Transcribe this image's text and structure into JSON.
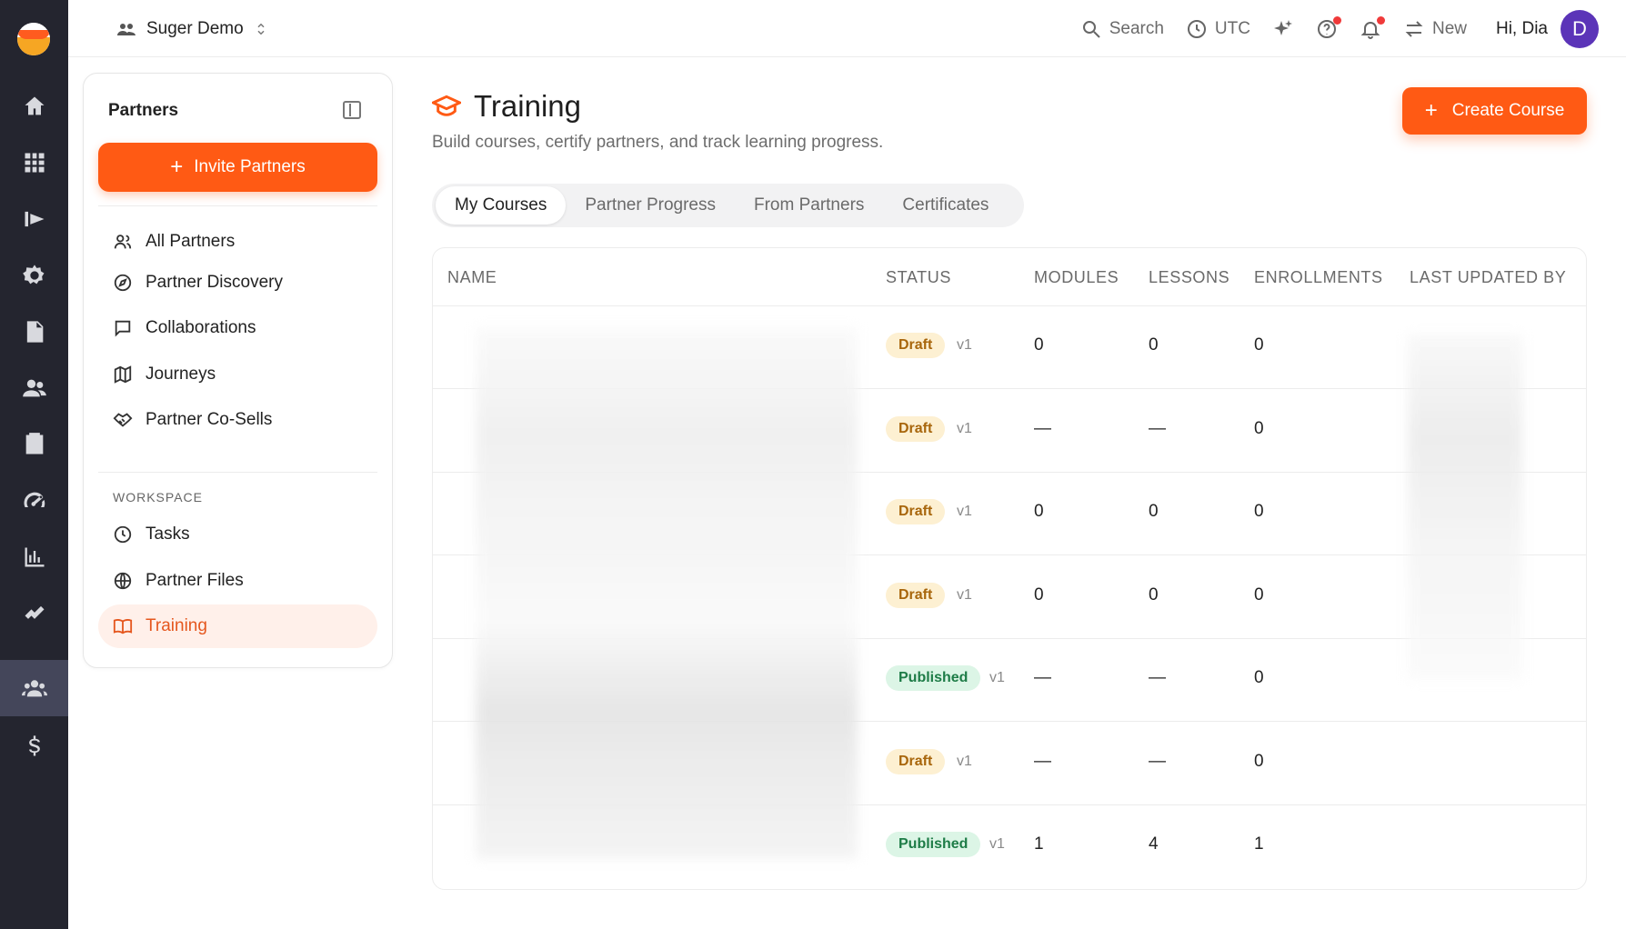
{
  "topbar": {
    "workspace_name": "Suger Demo",
    "search_label": "Search",
    "timezone_label": "UTC",
    "new_label": "New",
    "greeting": "Hi, Dia",
    "avatar_initial": "D"
  },
  "rail": {
    "icons": [
      "home-icon",
      "apps-icon",
      "marketplace-icon",
      "settings-icon",
      "document-icon",
      "people-icon",
      "contacts-icon",
      "speedometer-icon",
      "analytics-icon",
      "integrations-icon",
      "partners-icon",
      "billing-icon"
    ],
    "active": "partners-icon"
  },
  "sidebar": {
    "title": "Partners",
    "invite_label": "Invite Partners",
    "items": [
      {
        "label": "All Partners",
        "icon": "users-icon"
      },
      {
        "label": "Partner Discovery",
        "icon": "compass-icon"
      },
      {
        "label": "Collaborations",
        "icon": "chat-icon"
      },
      {
        "label": "Journeys",
        "icon": "map-icon"
      },
      {
        "label": "Partner Co-Sells",
        "icon": "handshake-icon"
      }
    ],
    "workspace_label": "WORKSPACE",
    "workspace_items": [
      {
        "label": "Tasks",
        "icon": "clock-icon"
      },
      {
        "label": "Partner Files",
        "icon": "globe-icon"
      },
      {
        "label": "Training",
        "icon": "book-icon",
        "active": true
      }
    ]
  },
  "main": {
    "title": "Training",
    "subtitle": "Build courses, certify partners, and track learning progress.",
    "create_label": "Create Course",
    "tabs": [
      {
        "label": "My Courses",
        "active": true
      },
      {
        "label": "Partner Progress"
      },
      {
        "label": "From Partners"
      },
      {
        "label": "Certificates"
      }
    ],
    "table": {
      "headers": [
        "NAME",
        "STATUS",
        "MODULES",
        "LESSONS",
        "ENROLLMENTS",
        "LAST UPDATED BY"
      ],
      "rows": [
        {
          "status": "Draft",
          "version": "v1",
          "modules": "0",
          "lessons": "0",
          "enrollments": "0"
        },
        {
          "status": "Draft",
          "version": "v1",
          "modules": "—",
          "lessons": "—",
          "enrollments": "0"
        },
        {
          "status": "Draft",
          "version": "v1",
          "modules": "0",
          "lessons": "0",
          "enrollments": "0"
        },
        {
          "status": "Draft",
          "version": "v1",
          "modules": "0",
          "lessons": "0",
          "enrollments": "0"
        },
        {
          "status": "Published",
          "version": "v1",
          "modules": "—",
          "lessons": "—",
          "enrollments": "0"
        },
        {
          "status": "Draft",
          "version": "v1",
          "modules": "—",
          "lessons": "—",
          "enrollments": "0"
        },
        {
          "status": "Published",
          "version": "v1",
          "modules": "1",
          "lessons": "4",
          "enrollments": "1"
        }
      ]
    }
  },
  "colors": {
    "accent": "#ff5a14",
    "rail_bg": "#24252f",
    "draft_bg": "#fdf0d2",
    "draft_text": "#a8660c",
    "published_bg": "#dcf5e6",
    "published_text": "#1e7c47",
    "avatar_bg": "#5b34b8"
  }
}
